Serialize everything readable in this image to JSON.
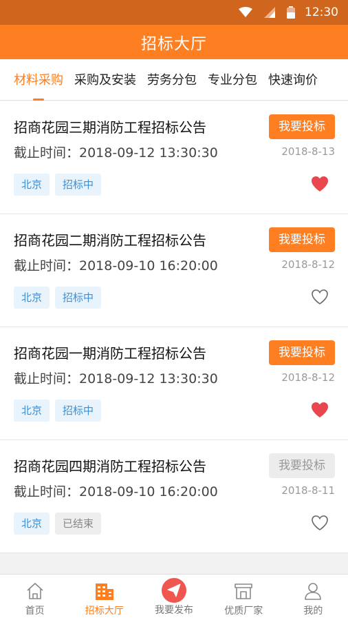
{
  "status_bar": {
    "time": "12:30"
  },
  "header": {
    "title": "招标大厅"
  },
  "tabs": [
    {
      "label": "材料采购",
      "active": true
    },
    {
      "label": "采购及安装",
      "active": false
    },
    {
      "label": "劳务分包",
      "active": false
    },
    {
      "label": "专业分包",
      "active": false
    },
    {
      "label": "快速询价",
      "active": false
    }
  ],
  "cards": [
    {
      "title": "招商花园三期消防工程招标公告",
      "deadline": "截止时间：2018-09-12 13:30:30",
      "date": "2018-8-13",
      "button": "我要投标",
      "button_enabled": true,
      "tags": [
        "北京",
        "招标中"
      ],
      "favorited": true
    },
    {
      "title": "招商花园二期消防工程招标公告",
      "deadline": "截止时间：2018-09-10 16:20:00",
      "date": "2018-8-12",
      "button": "我要投标",
      "button_enabled": true,
      "tags": [
        "北京",
        "招标中"
      ],
      "favorited": false
    },
    {
      "title": "招商花园一期消防工程招标公告",
      "deadline": "截止时间：2018-09-12 13:30:30",
      "date": "2018-8-12",
      "button": "我要投标",
      "button_enabled": true,
      "tags": [
        "北京",
        "招标中"
      ],
      "favorited": true
    },
    {
      "title": "招商花园四期消防工程招标公告",
      "deadline": "截止时间：2018-09-10 16:20:00",
      "date": "2018-8-11",
      "button": "我要投标",
      "button_enabled": false,
      "tags": [
        "北京",
        "已结束"
      ],
      "favorited": false
    }
  ],
  "tabbar": [
    {
      "label": "首页",
      "icon": "home-icon",
      "active": false
    },
    {
      "label": "招标大厅",
      "icon": "building-icon",
      "active": true
    },
    {
      "label": "我要发布",
      "icon": "paper-plane-icon",
      "active": false
    },
    {
      "label": "优质厂家",
      "icon": "store-icon",
      "active": false
    },
    {
      "label": "我的",
      "icon": "user-icon",
      "active": false
    }
  ],
  "colors": {
    "accent": "#fd7f22",
    "status_bar": "#d0661d",
    "tag_blue": "#3a8fd6",
    "heart_red": "#e8474f"
  }
}
